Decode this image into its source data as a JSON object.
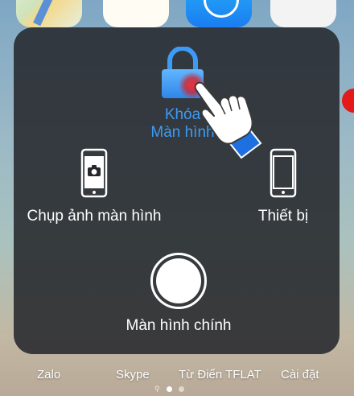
{
  "dock": {
    "apps": [
      {
        "label": "Zalo"
      },
      {
        "label": "Skype"
      },
      {
        "label": "Từ Điển TFLAT"
      },
      {
        "label": "Cài đặt"
      }
    ]
  },
  "assistive_touch": {
    "lock_screen": {
      "line1": "Khóa",
      "line2": "Màn hình"
    },
    "screenshot": {
      "label": "Chụp ảnh màn hình"
    },
    "device": {
      "label": "Thiết bị"
    },
    "home": {
      "label": "Màn hình chính"
    }
  },
  "page_indicator": {
    "pages": 3,
    "active_index": 0
  },
  "colors": {
    "panel_bg": "#26282c",
    "lock_accent": "#3d9bf5",
    "tap_highlight": "#e01818",
    "hand_sleeve": "#1e6fe0"
  },
  "icons": {
    "lock": "lock-icon",
    "screenshot": "camera-phone-icon",
    "device": "phone-icon",
    "home": "home-button-icon",
    "pointer": "hand-pointer-icon"
  }
}
